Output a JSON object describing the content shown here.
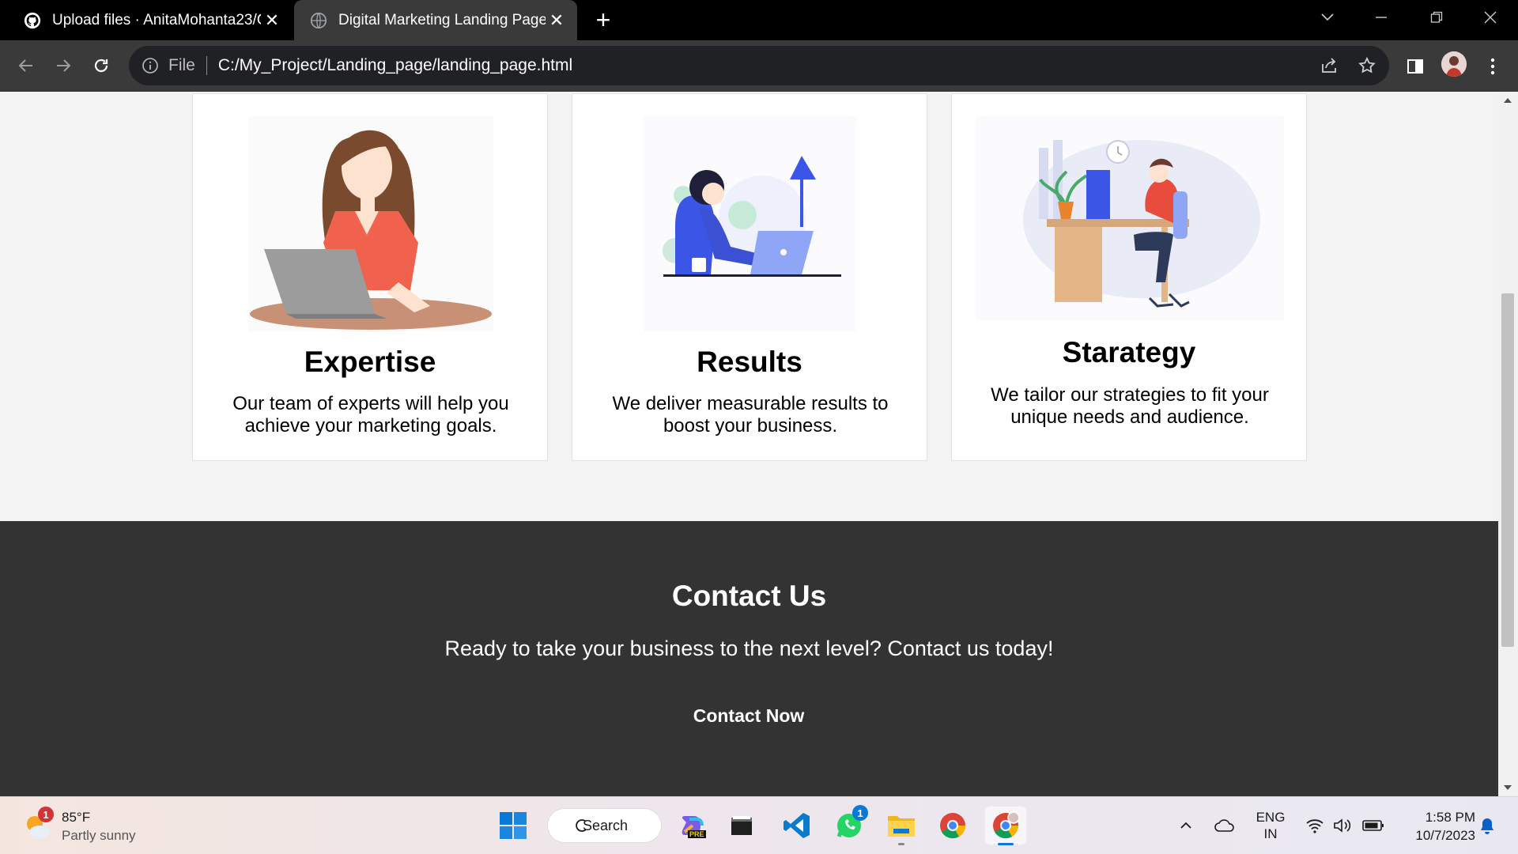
{
  "browser": {
    "tabs": [
      {
        "title": "Upload files · AnitaMohanta23/C",
        "active": false,
        "icon": "github-icon"
      },
      {
        "title": "Digital Marketing Landing Page",
        "active": true,
        "icon": "globe-icon"
      }
    ],
    "address": {
      "scheme_label": "File",
      "url": "C:/My_Project/Landing_page/landing_page.html"
    }
  },
  "page": {
    "features": [
      {
        "title": "Expertise",
        "description": "Our team of experts will help you achieve your marketing goals."
      },
      {
        "title": "Results",
        "description": "We deliver measurable results to boost your business."
      },
      {
        "title": "Starategy",
        "description": "We tailor our strategies to fit your unique needs and audience."
      }
    ],
    "contact": {
      "heading": "Contact Us",
      "text": "Ready to take your business to the next level? Contact us today!",
      "button": "Contact Now"
    }
  },
  "scroll": {
    "position_fraction": 0.58
  },
  "taskbar": {
    "weather": {
      "temp": "85°F",
      "condition": "Partly sunny",
      "badge": "1"
    },
    "search_label": "Search",
    "whatsapp_badge": "1",
    "copilot_tag": "PRE",
    "language": {
      "lang": "ENG",
      "region": "IN"
    },
    "clock": {
      "time": "1:58 PM",
      "date": "10/7/2023"
    }
  },
  "colors": {
    "chrome_dark": "#000000",
    "toolbar": "#3a3a3a",
    "footer": "#333333",
    "accent_blue": "#3b55e6",
    "accent_coral": "#f0624d"
  }
}
